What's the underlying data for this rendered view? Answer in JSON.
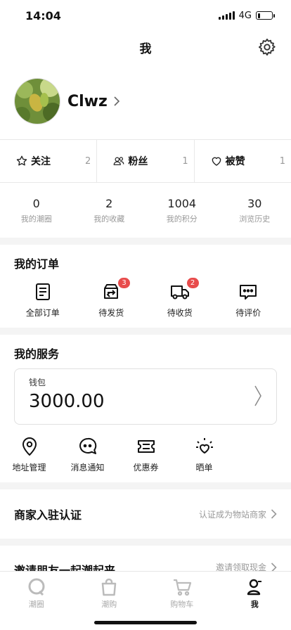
{
  "status_bar": {
    "time": "14:04",
    "network": "4G",
    "battery_level": 0.2
  },
  "header": {
    "title": "我",
    "settings_icon": "gear-icon"
  },
  "profile": {
    "username": "Clwz",
    "avatar_icon": "avatar-photo"
  },
  "social": [
    {
      "label": "关注",
      "count": "2",
      "icon": "star-icon"
    },
    {
      "label": "粉丝",
      "count": "1",
      "icon": "users-icon"
    },
    {
      "label": "被赞",
      "count": "1",
      "icon": "heart-icon"
    }
  ],
  "stats": [
    {
      "value": "0",
      "label": "我的潮圈"
    },
    {
      "value": "2",
      "label": "我的收藏"
    },
    {
      "value": "1004",
      "label": "我的积分"
    },
    {
      "value": "30",
      "label": "浏览历史"
    }
  ],
  "orders": {
    "title": "我的订单",
    "items": [
      {
        "label": "全部订单",
        "badge": "",
        "icon": "document-icon"
      },
      {
        "label": "待发货",
        "badge": "3",
        "icon": "box-icon"
      },
      {
        "label": "待收货",
        "badge": "2",
        "icon": "truck-icon"
      },
      {
        "label": "待评价",
        "badge": "",
        "icon": "chat-dots-icon"
      }
    ]
  },
  "services": {
    "title": "我的服务",
    "wallet": {
      "label": "钱包",
      "amount": "3000.00"
    },
    "items": [
      {
        "label": "地址管理",
        "icon": "location-pin-icon"
      },
      {
        "label": "消息通知",
        "icon": "message-bubble-icon"
      },
      {
        "label": "优惠券",
        "icon": "coupon-icon"
      },
      {
        "label": "晒单",
        "icon": "sun-heart-icon"
      }
    ]
  },
  "merchant": {
    "title": "商家入驻认证",
    "link": "认证成为物站商家"
  },
  "invite": {
    "title": "邀请朋友一起潮起来",
    "link": "邀请领取现金"
  },
  "tabs": [
    {
      "label": "潮圈",
      "icon": "circle-icon",
      "active": false
    },
    {
      "label": "潮购",
      "icon": "bag-icon",
      "active": false
    },
    {
      "label": "购物车",
      "icon": "cart-icon",
      "active": false
    },
    {
      "label": "我",
      "icon": "profile-icon",
      "active": true
    }
  ]
}
